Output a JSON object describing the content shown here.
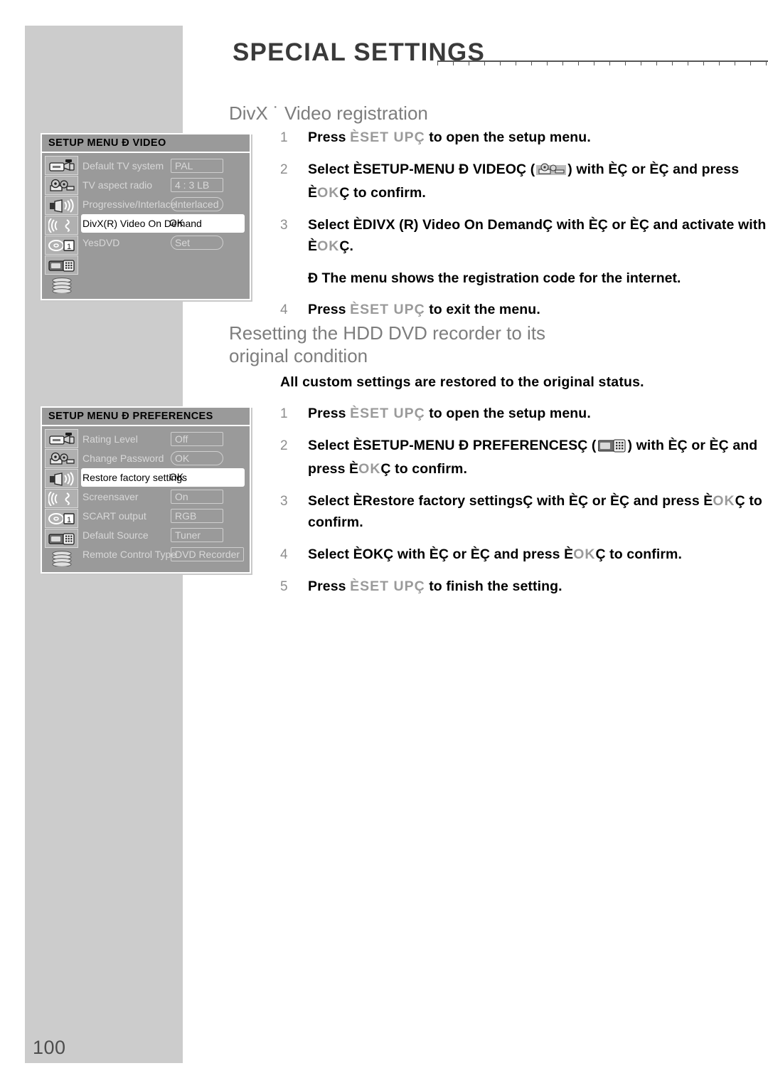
{
  "page": {
    "number": "100",
    "header_title": "SPECIAL SETTINGS"
  },
  "sections": [
    {
      "heading": "DivX ˙ Video registration",
      "steps": [
        {
          "num": "1",
          "parts": [
            {
              "t": "Press ",
              "style": "bold"
            },
            {
              "t": "ÈSET UPÇ",
              "style": "dim"
            },
            {
              "t": " to open the setup menu.",
              "style": "bold"
            }
          ]
        },
        {
          "num": "2",
          "parts": [
            {
              "t": "Select ÈSETUP-MENU Ð VIDEOÇ (",
              "style": "bold"
            },
            {
              "t": "",
              "style": "icon-film"
            },
            {
              "t": ") with È",
              "style": "bold"
            },
            {
              "t": "Ç or È",
              "style": "bold"
            },
            {
              "t": "Ç and press È",
              "style": "bold"
            },
            {
              "t": "OK",
              "style": "dim"
            },
            {
              "t": "Ç to confirm.",
              "style": "bold"
            }
          ]
        },
        {
          "num": "3",
          "parts": [
            {
              "t": "Select ÈDIVX (R) Video On DemandÇ with È",
              "style": "bold"
            },
            {
              "t": "Ç or È",
              "style": "bold"
            },
            {
              "t": "Ç and activate with È",
              "style": "bold"
            },
            {
              "t": "OK",
              "style": "dim"
            },
            {
              "t": "Ç.",
              "style": "bold"
            }
          ],
          "note": "Ð The menu shows the registration code for the internet."
        },
        {
          "num": "4",
          "parts": [
            {
              "t": "Press ",
              "style": "bold"
            },
            {
              "t": "ÈSET UPÇ",
              "style": "dim"
            },
            {
              "t": " to exit the menu.",
              "style": "bold"
            }
          ]
        }
      ]
    },
    {
      "heading": "Resetting the HDD DVD recorder to its original condition",
      "intro": "All custom settings are restored to the original status.",
      "steps": [
        {
          "num": "1",
          "parts": [
            {
              "t": "Press ",
              "style": "bold"
            },
            {
              "t": "ÈSET UPÇ",
              "style": "dim"
            },
            {
              "t": " to open the setup menu.",
              "style": "bold"
            }
          ]
        },
        {
          "num": "2",
          "parts": [
            {
              "t": "Select ÈSETUP-MENU Ð PREFERENCESÇ (",
              "style": "bold"
            },
            {
              "t": "",
              "style": "icon-remote"
            },
            {
              "t": ") with È",
              "style": "bold"
            },
            {
              "t": "Ç or È",
              "style": "bold"
            },
            {
              "t": "Ç and press È",
              "style": "bold"
            },
            {
              "t": "OK",
              "style": "dim"
            },
            {
              "t": "Ç to confirm.",
              "style": "bold"
            }
          ]
        },
        {
          "num": "3",
          "parts": [
            {
              "t": "Select ÈRestore factory settingsÇ with È",
              "style": "bold"
            },
            {
              "t": "Ç or È",
              "style": "bold"
            },
            {
              "t": "Ç and press È",
              "style": "bold"
            },
            {
              "t": "OK",
              "style": "dim"
            },
            {
              "t": "Ç to confirm.",
              "style": "bold"
            }
          ]
        },
        {
          "num": "4",
          "parts": [
            {
              "t": "Select ÈOKÇ with È",
              "style": "bold"
            },
            {
              "t": "Ç or È",
              "style": "bold"
            },
            {
              "t": "Ç and press È",
              "style": "bold"
            },
            {
              "t": "OK",
              "style": "dim"
            },
            {
              "t": "Ç to confirm.",
              "style": "bold"
            }
          ]
        },
        {
          "num": "5",
          "parts": [
            {
              "t": "Press ",
              "style": "bold"
            },
            {
              "t": "ÈSET UPÇ",
              "style": "dim"
            },
            {
              "t": " to finish the setting.",
              "style": "bold"
            }
          ]
        }
      ]
    }
  ],
  "osd_video": {
    "title": "SETUP MENU Ð VIDEO",
    "icons": [
      "camcorder-icon",
      "film-projector-icon",
      "speaker-icon",
      "soundwave-icon",
      "disc-calendar-icon",
      "remote-control-icon",
      "disc-stack-icon"
    ],
    "rows": [
      {
        "label": "Default TV system",
        "value": "PAL",
        "shape": "sq",
        "selected": false
      },
      {
        "label": "TV aspect radio",
        "value": "4 : 3 LB",
        "shape": "sq",
        "selected": false
      },
      {
        "label": "Progressive/Interlace",
        "value": "Interlaced",
        "shape": "pill",
        "selected": false
      },
      {
        "label": "DivX(R) Video On Demand",
        "value": "OK",
        "shape": "sq",
        "selected": true
      },
      {
        "label": "YesDVD",
        "value": "Set",
        "shape": "pill",
        "selected": false
      }
    ]
  },
  "osd_pref": {
    "title": "SETUP MENU Ð PREFERENCES",
    "icons": [
      "camcorder-icon",
      "film-projector-icon",
      "speaker-icon",
      "soundwave-icon",
      "disc-calendar-icon",
      "remote-control-icon",
      "disc-stack-icon"
    ],
    "rows": [
      {
        "label": "Rating Level",
        "value": "Off",
        "shape": "sq",
        "selected": false
      },
      {
        "label": "Change Password",
        "value": "OK",
        "shape": "pill",
        "selected": false
      },
      {
        "label": "Restore factory settings",
        "value": "OK",
        "shape": "sq",
        "selected": true
      },
      {
        "label": "Screensaver",
        "value": "On",
        "shape": "sq",
        "selected": false
      },
      {
        "label": "SCART output",
        "value": "RGB",
        "shape": "sq",
        "selected": false
      },
      {
        "label": "Default Source",
        "value": "Tuner",
        "shape": "sq",
        "selected": false
      },
      {
        "label": "Remote Control Type",
        "value": "DVD Recorder",
        "shape": "sq",
        "selected": false
      }
    ]
  },
  "colors": {
    "side_bar": "#cccccc",
    "osd_bg": "#9a9a9a",
    "osd_text": "#d8d8d8",
    "heading": "#7d7d7d",
    "title": "#3a3a3a"
  }
}
